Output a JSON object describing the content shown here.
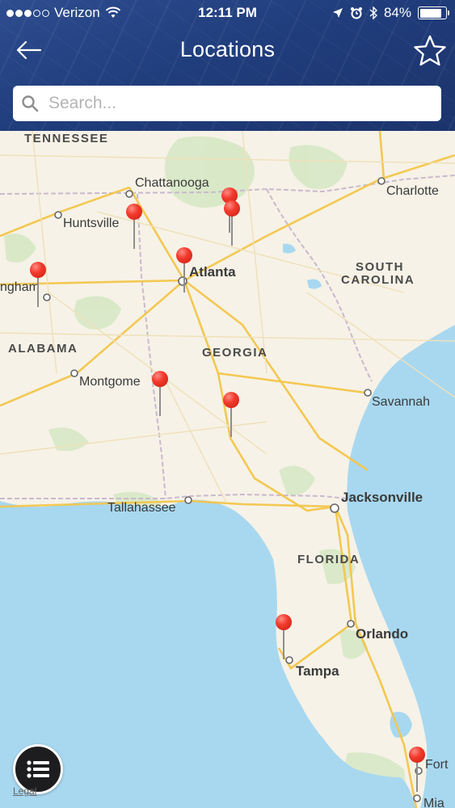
{
  "status_bar": {
    "carrier": "Verizon",
    "time": "12:11 PM",
    "battery": "84%",
    "battery_level": 0.84
  },
  "nav": {
    "title": "Locations",
    "back_icon": "back-arrow-icon",
    "favorite_icon": "star-icon"
  },
  "search": {
    "placeholder": "Search...",
    "value": ""
  },
  "map": {
    "states": {
      "tennessee": "TENNESSEE",
      "alabama": "ALABAMA",
      "georgia": "GEORGIA",
      "south_carolina_1": "SOUTH",
      "south_carolina_2": "CAROLINA",
      "florida": "FLORIDA"
    },
    "cities": {
      "chattanooga": "Chattanooga",
      "huntsville": "Huntsville",
      "charlotte": "Charlotte",
      "atlanta": "Atlanta",
      "birmingham": "ngham",
      "montgomery": "Montgome",
      "savannah": "Savannah",
      "tallahassee": "Tallahassee",
      "jacksonville": "Jacksonville",
      "orlando": "Orlando",
      "tampa": "Tampa",
      "fort": "Fort",
      "miami": "Mia"
    },
    "pin_count": 10,
    "legal": "Legal"
  },
  "list_button": {
    "icon": "list-icon"
  },
  "colors": {
    "header": "#203d7c",
    "pin": "#f23a2c",
    "water": "#a8d8f0",
    "land": "#f6f2e7",
    "road": "#f3c64b"
  }
}
